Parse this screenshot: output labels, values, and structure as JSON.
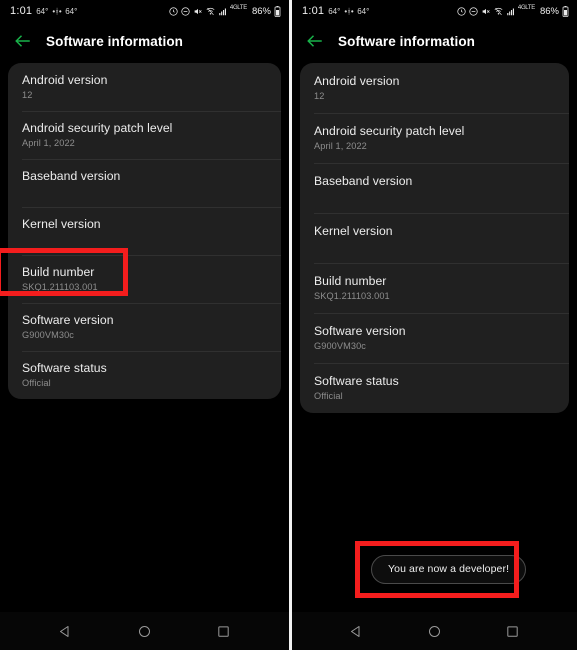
{
  "status_bar": {
    "clock": "1:01",
    "temp_current": "64°",
    "wind": "•ᚼ•",
    "temp_secondary": "64°",
    "network_label": "4GLTE",
    "battery_percent": "86%",
    "icons": [
      "alarm-icon",
      "do-not-disturb-icon",
      "mute-icon",
      "wifi-icon",
      "signal-icon",
      "battery-icon"
    ]
  },
  "app_bar": {
    "back_label": "back-arrow",
    "title": "Software information",
    "accent_color": "#18b34a"
  },
  "list": {
    "rows": [
      {
        "title": "Android version",
        "value": "12"
      },
      {
        "title": "Android security patch level",
        "value": "April 1, 2022"
      },
      {
        "title": "Baseband version",
        "value": ""
      },
      {
        "title": "Kernel version",
        "value": ""
      },
      {
        "title": "Build number",
        "value": "SKQ1.211103.001"
      },
      {
        "title": "Software version",
        "value": "G900VM30c"
      },
      {
        "title": "Software status",
        "value": "Official"
      }
    ]
  },
  "annotations": {
    "highlight_color": "#f41d1d",
    "build_number_box": "build-number-row-highlight",
    "toast_box": "toast-highlight"
  },
  "toast": {
    "message": "You are now a developer!"
  },
  "nav_bar": {
    "back": "back-triangle-icon",
    "home": "home-circle-icon",
    "recents": "recents-square-icon"
  }
}
